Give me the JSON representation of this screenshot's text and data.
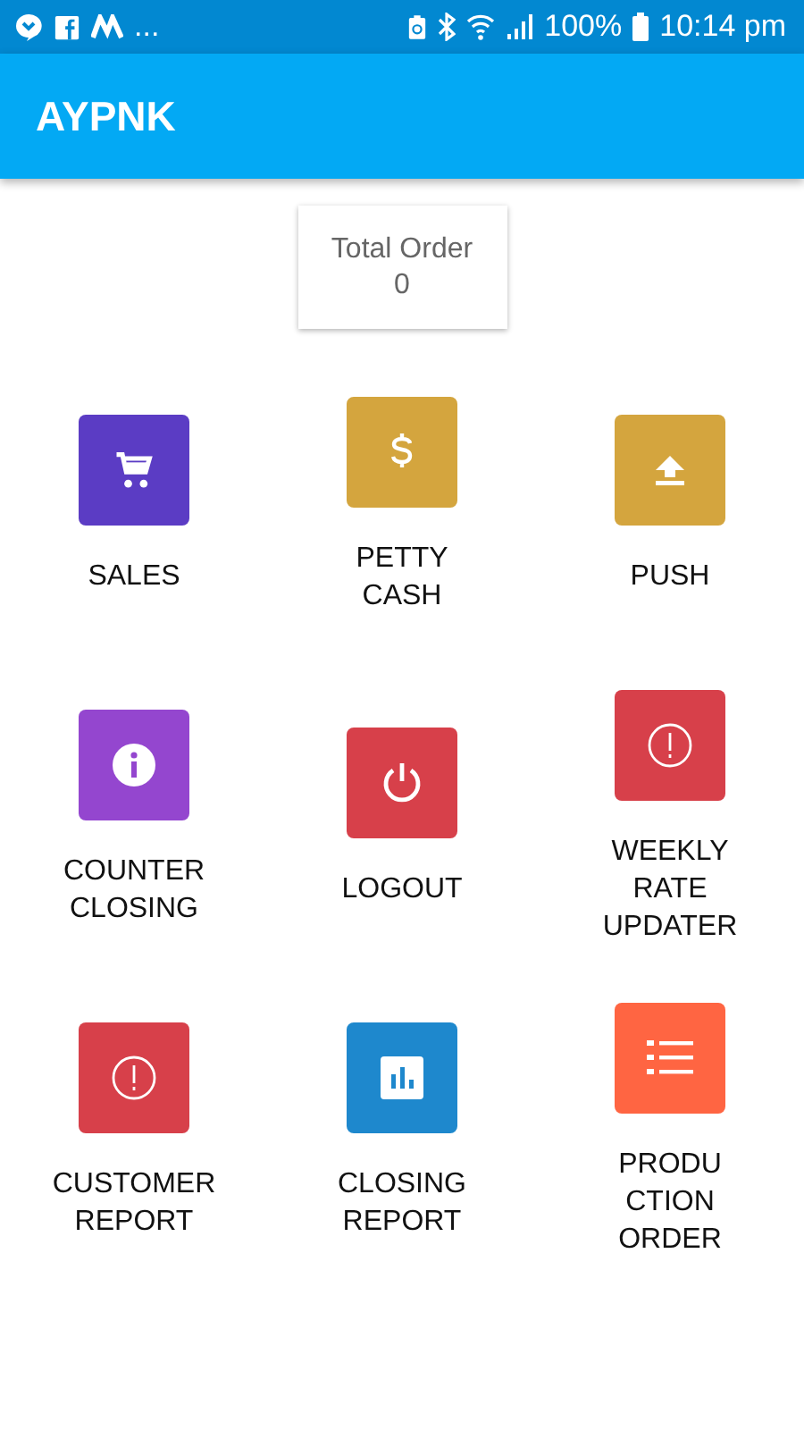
{
  "status_bar": {
    "overflow": "...",
    "battery": "100%",
    "time": "10:14 pm"
  },
  "app_bar": {
    "title": "AYPNK"
  },
  "summary": {
    "label": "Total Order",
    "value": "0"
  },
  "tiles": [
    {
      "kind": "cart",
      "color": "#5b3cc4",
      "label_lines": [
        "SALES"
      ]
    },
    {
      "kind": "dollar",
      "color": "#d4a53e",
      "label_lines": [
        "PETTY",
        "CASH"
      ]
    },
    {
      "kind": "upload",
      "color": "#d4a53e",
      "label_lines": [
        "PUSH"
      ]
    },
    {
      "kind": "info",
      "color": "#9446cf",
      "label_lines": [
        "COUNTER",
        "CLOSING"
      ]
    },
    {
      "kind": "power",
      "color": "#d7404a",
      "label_lines": [
        "LOGOUT"
      ]
    },
    {
      "kind": "alert",
      "color": "#d7404a",
      "label_lines": [
        "WEEKLY",
        "RATE",
        "UPDATER"
      ]
    },
    {
      "kind": "alert",
      "color": "#d7404a",
      "label_lines": [
        "CUSTOMER",
        "REPORT"
      ]
    },
    {
      "kind": "chart",
      "color": "#1e88cd",
      "label_lines": [
        "CLOSING",
        "REPORT"
      ]
    },
    {
      "kind": "list",
      "color": "#ff6542",
      "label_lines": [
        "PRODU",
        "CTION",
        "ORDER"
      ]
    }
  ]
}
